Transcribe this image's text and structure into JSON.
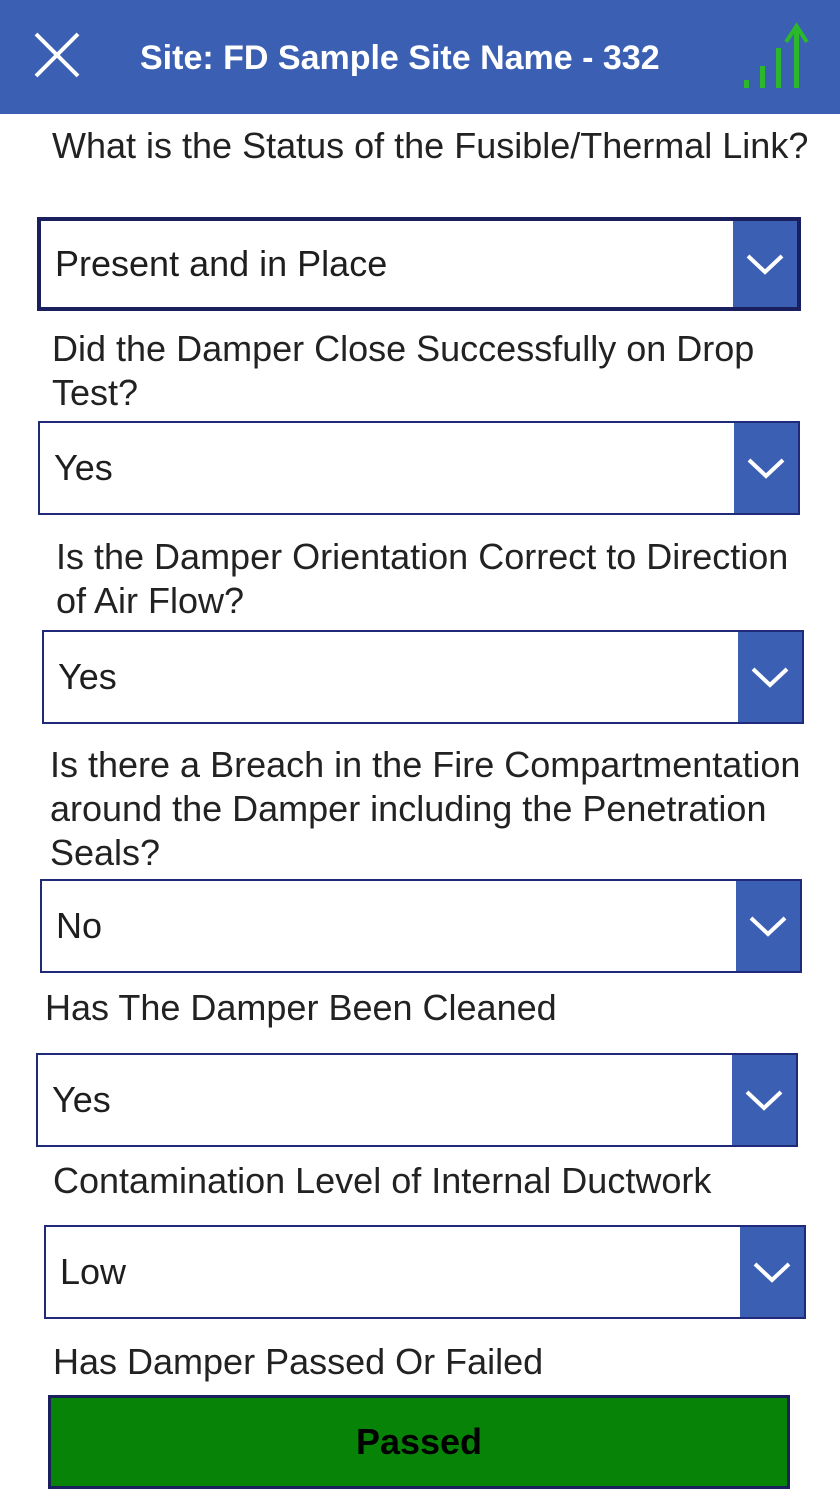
{
  "header": {
    "title": "Site: FD Sample Site Name - 332",
    "close_icon": "close-icon",
    "signal_icon": "signal-upload-icon",
    "background": "#3b5fb3",
    "signal_color": "#2bb82b"
  },
  "questions": [
    {
      "label": "What is the Status of the Fusible/Thermal Link?",
      "value": "Present and in Place"
    },
    {
      "label": "Did the Damper Close Successfully on Drop Test?",
      "value": "Yes"
    },
    {
      "label": "Is the Damper Orientation Correct to Direction of Air Flow?",
      "value": "Yes"
    },
    {
      "label": "Is there a Breach in the Fire Compartmentation around the Damper including the Penetration Seals?",
      "value": "No"
    },
    {
      "label": "Has The Damper Been Cleaned",
      "value": "Yes"
    },
    {
      "label": "Contamination Level of Internal Ductwork",
      "value": "Low"
    }
  ],
  "result": {
    "label": "Has Damper Passed Or Failed",
    "value": "Passed",
    "color": "#078407"
  },
  "dropdown_icon": "chevron-down-icon",
  "accent": "#3b5fb3"
}
